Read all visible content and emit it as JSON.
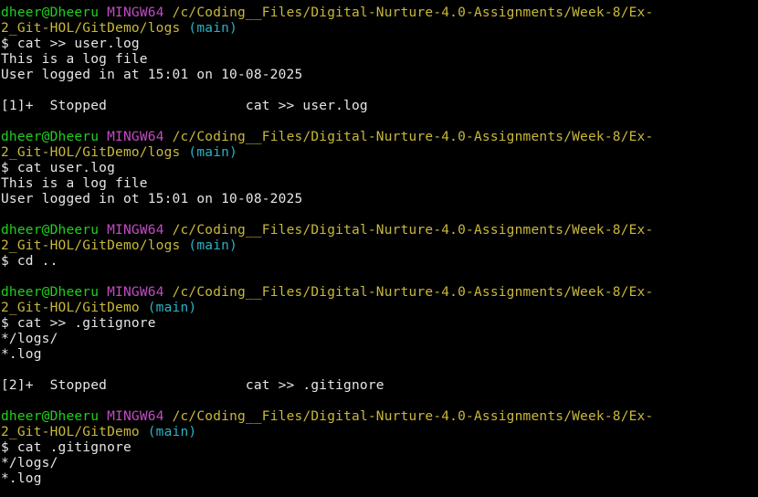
{
  "theme": {
    "background": "#000000",
    "text": "#e6e6e6",
    "user_color": "#1fd01f",
    "mingw_color": "#c24bc4",
    "path_color": "#c9b83a",
    "branch_color": "#2ab3c4"
  },
  "prompt": {
    "user": "dheer@Dheeru",
    "system": "MINGW64",
    "path_prefix": "/c/Coding__Files/Digital-Nurture-4.0-Assignments/Week-8/Ex-",
    "path_logs": "2_Git-HOL/GitDemo/logs",
    "path_root": "2_Git-HOL/GitDemo",
    "branch": "(main)"
  },
  "lines": {
    "cmd1": "$ cat >> user.log",
    "out1a": "This is a log file",
    "out1b": "User logged in at 15:01 on 10-08-2025",
    "job1": "[1]+  Stopped                 cat >> user.log",
    "cmd2": "$ cat user.log",
    "out2a": "This is a log file",
    "out2b": "User logged in ot 15:01 on 10-08-2025",
    "cmd3": "$ cd ..",
    "cmd4": "$ cat >> .gitignore",
    "out4a": "*/logs/",
    "out4b": "*.log",
    "job2": "[2]+  Stopped                 cat >> .gitignore",
    "cmd5": "$ cat .gitignore",
    "out5a": "*/logs/",
    "out5b": "*.log"
  }
}
